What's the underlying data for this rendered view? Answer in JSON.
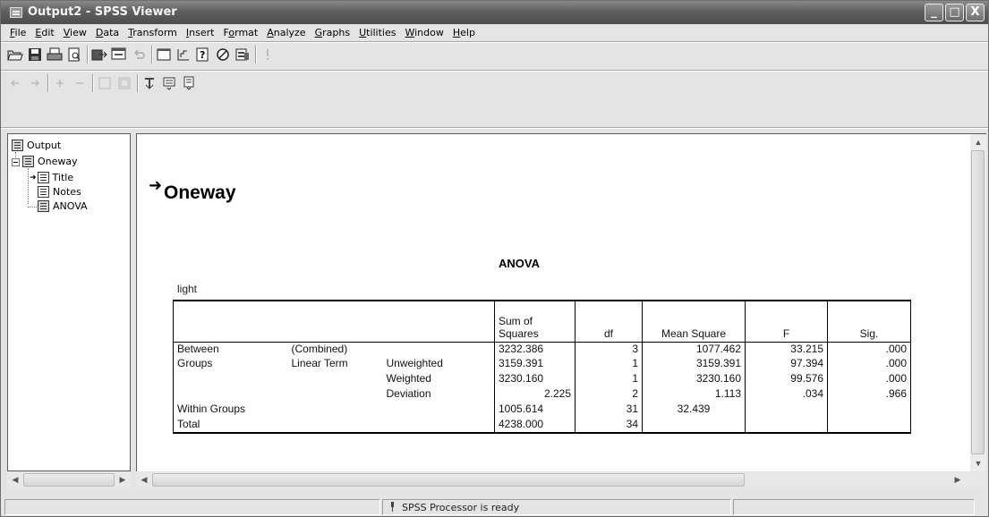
{
  "window": {
    "title": "Output2 - SPSS Viewer",
    "minimize": "_",
    "maximize": "□",
    "close": "X"
  },
  "menu": [
    {
      "label": "File",
      "u": "F",
      "rest": "ile"
    },
    {
      "label": "Edit",
      "u": "E",
      "rest": "dit"
    },
    {
      "label": "View",
      "u": "V",
      "rest": "iew"
    },
    {
      "label": "Data",
      "u": "D",
      "rest": "ata"
    },
    {
      "label": "Transform",
      "u": "T",
      "rest": "ransform"
    },
    {
      "label": "Insert",
      "u": "I",
      "rest": "nsert"
    },
    {
      "label": "Format",
      "u": "o",
      "pre": "F",
      "rest": "rmat"
    },
    {
      "label": "Analyze",
      "u": "A",
      "rest": "nalyze"
    },
    {
      "label": "Graphs",
      "u": "G",
      "rest": "raphs"
    },
    {
      "label": "Utilities",
      "u": "U",
      "rest": "tilities"
    },
    {
      "label": "Window",
      "u": "W",
      "rest": "indow"
    },
    {
      "label": "Help",
      "u": "H",
      "rest": "elp"
    }
  ],
  "outline": {
    "root": "Output",
    "oneway": "Oneway",
    "title": "Title",
    "notes": "Notes",
    "anova": "ANOVA"
  },
  "content": {
    "heading": "Oneway",
    "arrow": "➜",
    "table_title": "ANOVA",
    "dependent": "light",
    "headers": {
      "sum_sq_1": "Sum of",
      "sum_sq_2": "Squares",
      "df": "df",
      "mean_square": "Mean Square",
      "f": "F",
      "sig": "Sig."
    },
    "rows": {
      "between_1": "Between",
      "between_2": "Groups",
      "combined": "(Combined)",
      "linear_term": "Linear Term",
      "unweighted": "Unweighted",
      "weighted": "Weighted",
      "deviation": "Deviation",
      "within": "Within Groups",
      "total": "Total"
    },
    "values": {
      "combined": {
        "ss": "3232.386",
        "df": "3",
        "ms": "1077.462",
        "f": "33.215",
        "sig": ".000"
      },
      "unweighted": {
        "ss": "3159.391",
        "df": "1",
        "ms": "3159.391",
        "f": "97.394",
        "sig": ".000"
      },
      "weighted": {
        "ss": "3230.160",
        "df": "1",
        "ms": "3230.160",
        "f": "99.576",
        "sig": ".000"
      },
      "deviation": {
        "ss": "2.225",
        "df": "2",
        "ms": "1.113",
        "f": ".034",
        "sig": ".966"
      },
      "within": {
        "ss": "1005.614",
        "df": "31",
        "ms": "32.439"
      },
      "total": {
        "ss": "4238.000",
        "df": "34"
      }
    }
  },
  "status": {
    "text": "SPSS Processor  is ready"
  }
}
